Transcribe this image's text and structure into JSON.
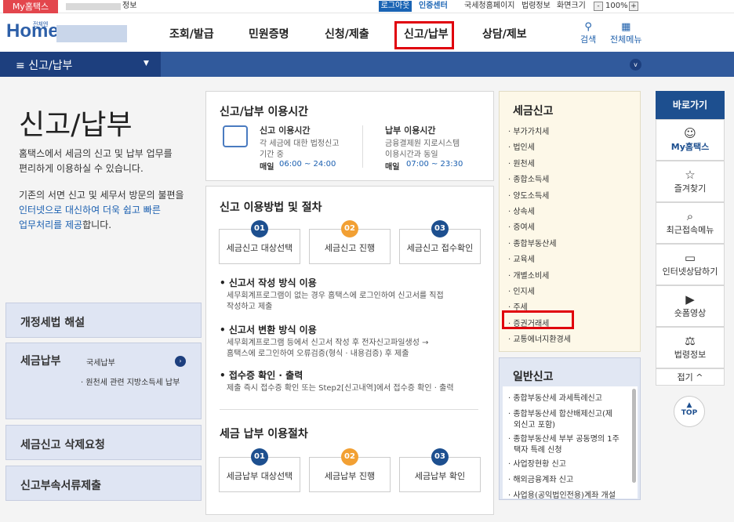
{
  "topbar": {
    "mytax": "My홈택스",
    "logout": "로그아웃",
    "cert_center": "인증센터",
    "links": [
      "국세청홈페이지",
      "법령정보",
      "화면크기"
    ],
    "zoom": "100%",
    "zoom_minus": "-",
    "zoom_plus": "+",
    "blurred_text": "정보"
  },
  "header": {
    "logo": "Home",
    "logo_small": "전체엔",
    "nav": [
      "조회/발급",
      "민원증명",
      "신청/제출",
      "신고/납부",
      "상담/제보"
    ],
    "search_label": "검색",
    "menu_label": "전체메뉴"
  },
  "breadcrumb": {
    "label": "신고/납부"
  },
  "left": {
    "title": "신고/납부",
    "desc1": "홈택스에서 세금의 신고 및 납부 업무를",
    "desc2": "편리하게 이용하실 수 있습니다.",
    "desc3": "기존의 서면 신고 및 세무서 방문의 불편을",
    "desc4_blue": "인터넷으로 대신하여 더욱 쉽고 빠른",
    "desc5_blue": "업무처리를 제공",
    "desc5_rest": "합니다.",
    "box1": "개정세법 해설",
    "box2": "세금납부",
    "box2_item1": "국세납부",
    "box2_item2": "· 원천세 관련 지방소득세 납부",
    "box3": "세금신고 삭제요청",
    "box4": "신고부속서류제출"
  },
  "hours": {
    "title": "신고/납부 이용시간",
    "col1_title": "신고 이용시간",
    "col1_l1": "각 세금에 대한 법정신고",
    "col1_l2": "기간 중",
    "col1_day": "매일",
    "col1_time": "06:00 ~ 24:00",
    "col2_title": "납부 이용시간",
    "col2_l1": "금융결제원 지로시스템",
    "col2_l2": "이용시간과 동일",
    "col2_day": "매일",
    "col2_time": "07:00 ~ 23:30"
  },
  "proc": {
    "title": "신고 이용방법 및 절차",
    "steps": [
      {
        "n": "01",
        "label": "세금신고 대상선택"
      },
      {
        "n": "02",
        "label": "세금신고 진행"
      },
      {
        "n": "03",
        "label": "세금신고 접수확인"
      }
    ],
    "s1_h": "신고서 작성 방식 이용",
    "s1_t1": "세무회계프로그램이 없는 경우 홈택스에 로그인하여 신고서를 직접",
    "s1_t2": "작성하고 제출",
    "s2_h": "신고서 변환 방식 이용",
    "s2_t1": "세무회계프로그램 등에서 신고서 작성 후 전자신고파일생성 →",
    "s2_t2": "홈택스에 로그인하여 오류검증(형식 · 내용검증) 후 제출",
    "s3_h": "접수증 확인 · 출력",
    "s3_t1": "제출 즉시 접수증 확인 또는 Step2[신고내역]에서 접수증 확인 · 출력",
    "pay_title": "세금 납부 이용절차",
    "pay_steps": [
      {
        "n": "01",
        "label": "세금납부 대상선택"
      },
      {
        "n": "02",
        "label": "세금납부 진행"
      },
      {
        "n": "03",
        "label": "세금납부 확인"
      }
    ]
  },
  "tax_report": {
    "title": "세금신고",
    "items": [
      "부가가치세",
      "법인세",
      "원천세",
      "종합소득세",
      "양도소득세",
      "상속세",
      "증여세",
      "종합부동산세",
      "교육세",
      "개별소비세",
      "인지세",
      "주세",
      "증권거래세",
      "교통에너지환경세"
    ]
  },
  "general": {
    "title": "일반신고",
    "items": [
      "종합부동산세 과세특례신고",
      "종합부동산세 합산배제신고(제",
      "외신고 포함)",
      "종합부동산세 부부 공동명의 1주",
      "택자 특례 신청",
      "사업장현황 신고",
      "해외금융계좌 신고",
      "사업용(공익법인전용)계좌 개설"
    ]
  },
  "quick": {
    "title": "바로가기",
    "items": [
      "My홈택스",
      "즐겨찾기",
      "최근접속메뉴",
      "인터넷상담하기",
      "숏폼영상",
      "법령정보"
    ],
    "fold": "접기 ^",
    "top": "TOP"
  },
  "colors": {
    "accent": "#1d4f8f",
    "highlight": "#e0000c",
    "orange": "#f2a033"
  }
}
